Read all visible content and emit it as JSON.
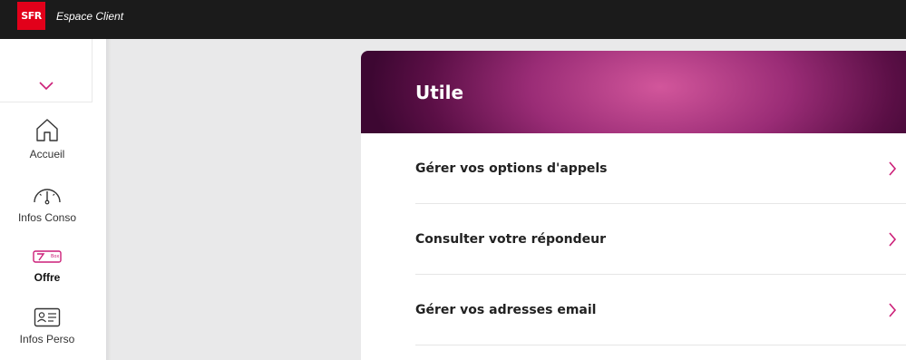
{
  "header": {
    "logo_text": "SFR",
    "app_title": "Espace Client",
    "brand_color": "#e2001a"
  },
  "sidebar": {
    "collapse_icon": "chevron-down-icon",
    "items": [
      {
        "label": "Accueil",
        "icon": "home-icon",
        "active": false
      },
      {
        "label": "Infos Conso",
        "icon": "gauge-icon",
        "active": false
      },
      {
        "label": "Offre",
        "icon": "offer-icon",
        "active": true,
        "icon_text": "Box"
      },
      {
        "label": "Infos Perso",
        "icon": "id-card-icon",
        "active": false
      }
    ],
    "accent_color": "#cc1f78"
  },
  "main": {
    "card_title": "Utile",
    "rows": [
      {
        "label": "Gérer vos options d'appels",
        "icon": "chevron-right-icon"
      },
      {
        "label": "Consulter votre répondeur",
        "icon": "chevron-right-icon"
      },
      {
        "label": "Gérer vos adresses email",
        "icon": "chevron-right-icon"
      }
    ]
  }
}
